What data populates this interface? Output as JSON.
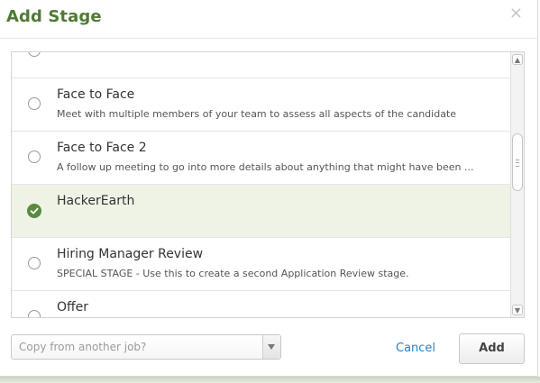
{
  "dialog": {
    "title": "Add Stage",
    "close_glyph": "×"
  },
  "stages": [
    {
      "name": "",
      "description": "",
      "selected": false
    },
    {
      "name": "Face to Face",
      "description": "Meet with multiple members of your team to assess all aspects of the candidate",
      "selected": false
    },
    {
      "name": "Face to Face 2",
      "description": "A follow up meeting to go into more details about anything that might have been ...",
      "selected": false
    },
    {
      "name": "HackerEarth",
      "description": "",
      "selected": true
    },
    {
      "name": "Hiring Manager Review",
      "description": "SPECIAL STAGE - Use this to create a second Application Review stage.",
      "selected": false
    },
    {
      "name": "Offer",
      "description": "",
      "selected": false
    }
  ],
  "footer": {
    "copy_placeholder": "Copy from another job?",
    "cancel_label": "Cancel",
    "add_label": "Add"
  },
  "icons": {
    "close": "close-icon",
    "selected": "checkmark-circle-icon",
    "dropdown": "chevron-down-icon"
  },
  "colors": {
    "title": "#4f7a34",
    "selected_bg": "#eef3e6",
    "check": "#5b8a3e",
    "link": "#2a82c4"
  }
}
